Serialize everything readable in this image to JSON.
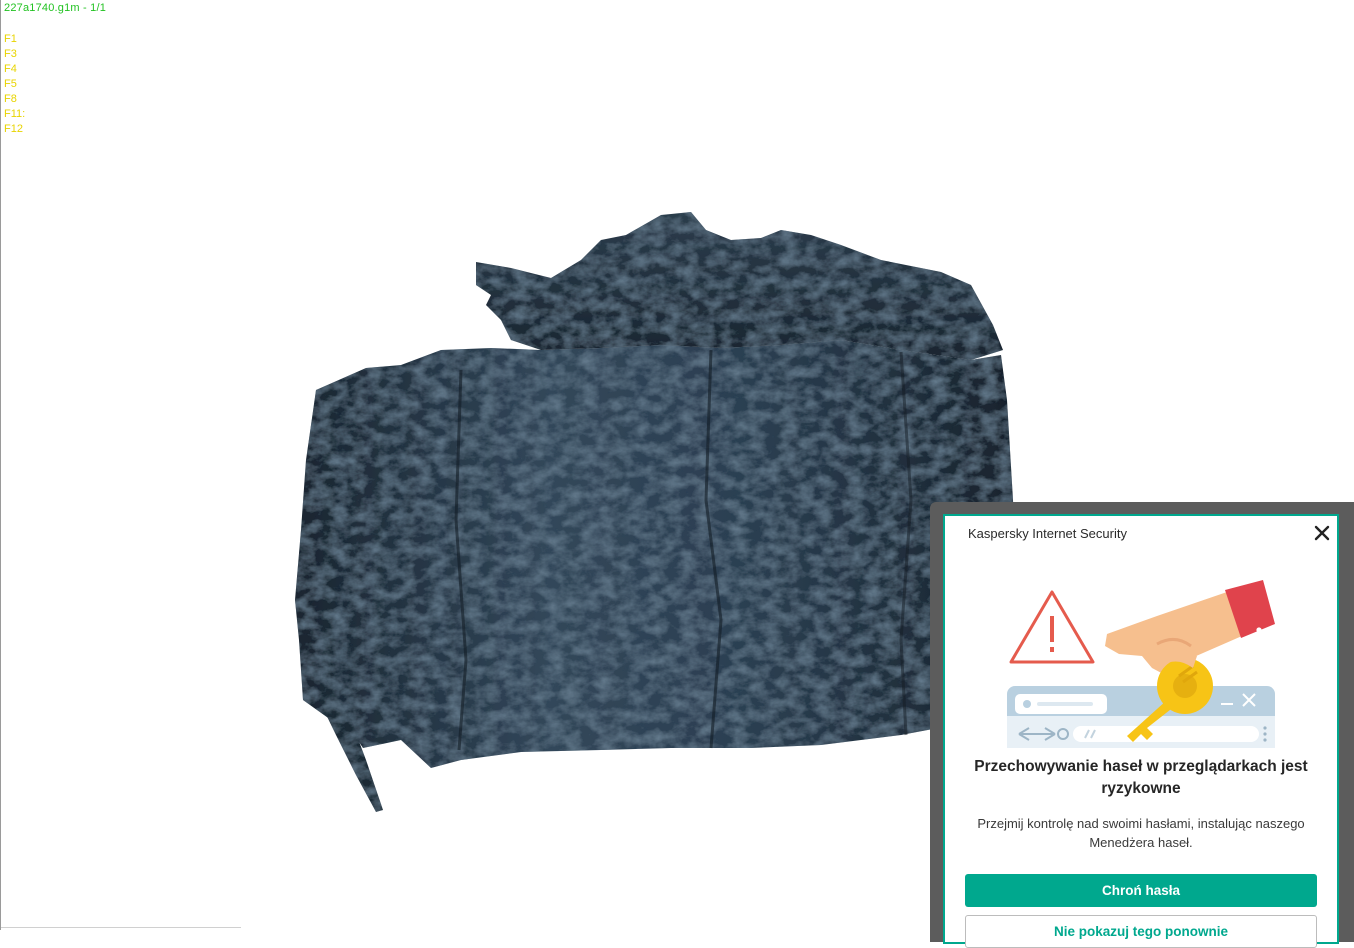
{
  "viewer": {
    "file_title": "227a1740.g1m - 1/1",
    "function_keys": [
      "F1",
      "F3",
      "F4",
      "F5",
      "F8",
      "F11:",
      "F12"
    ],
    "title_color": "#22c222",
    "keys_color": "#e8d400"
  },
  "popup": {
    "app_name": "Kaspersky Internet Security",
    "heading": "Przechowywanie haseł w przeglądarkach jest ryzykowne",
    "body": "Przejmij kontrolę nad swoimi hasłami, instalując naszego Menedżera haseł.",
    "primary_button": "Chroń hasła",
    "secondary_button": "Nie pokazuj tego ponownie",
    "accent_color": "#00a88e",
    "icons": [
      "close-icon",
      "warning-triangle-icon",
      "hand-icon",
      "key-icon",
      "browser-window-icon"
    ]
  }
}
